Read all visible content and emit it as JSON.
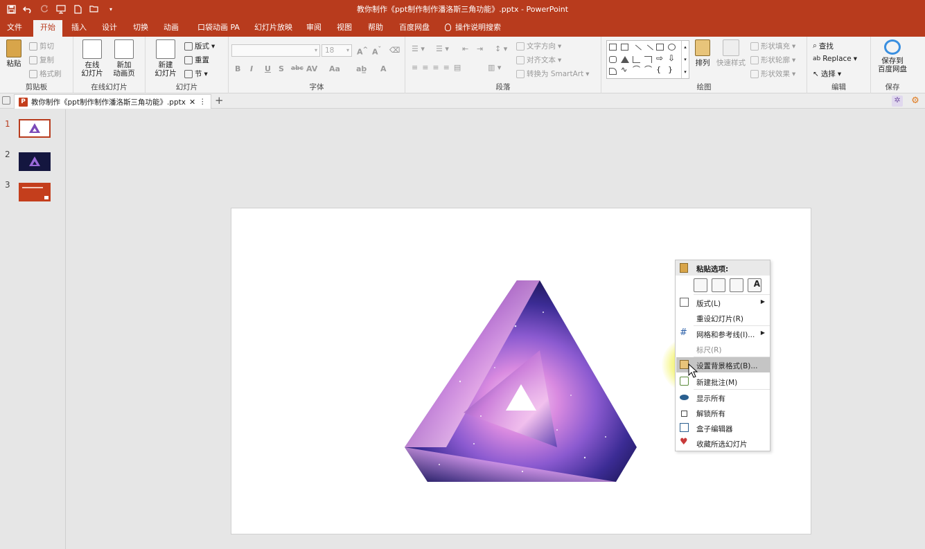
{
  "window": {
    "title": "教你制作《ppt制作制作潘洛斯三角功能》.pptx  -  PowerPoint"
  },
  "ribbon_tabs": [
    "文件",
    "开始",
    "插入",
    "设计",
    "切换",
    "动画",
    "口袋动画 PA",
    "幻灯片放映",
    "审阅",
    "视图",
    "帮助",
    "百度网盘",
    "操作说明搜索"
  ],
  "active_tab": "开始",
  "ribbon": {
    "clipboard": {
      "paste": "粘贴",
      "cut": "剪切",
      "copy": "复制",
      "format_painter": "格式刷",
      "label": "剪贴板"
    },
    "online": {
      "online_slide": "在线\n幻灯片",
      "new_anim": "新加\n动画页",
      "label": "在线幻灯片"
    },
    "slides": {
      "new_slide": "新建\n幻灯片",
      "layout": "版式",
      "reset": "重置",
      "section": "节",
      "label": "幻灯片"
    },
    "font": {
      "size": "18",
      "label": "字体",
      "buttons": [
        "B",
        "I",
        "U",
        "S",
        "abc",
        "AV",
        "Aa",
        "A"
      ]
    },
    "paragraph": {
      "text_dir": "文字方向",
      "align_text": "对齐文本",
      "smartart": "转换为 SmartArt",
      "label": "段落"
    },
    "drawing": {
      "arrange": "排列",
      "quick_styles": "快速样式",
      "fill": "形状填充",
      "outline": "形状轮廓",
      "effects": "形状效果",
      "label": "绘图"
    },
    "editing": {
      "find": "查找",
      "replace": "Replace",
      "select": "选择",
      "label": "编辑"
    },
    "save": {
      "save_to": "保存到\n百度网盘",
      "label": "保存"
    }
  },
  "doc_tab": {
    "name": "教你制作《ppt制作制作潘洛斯三角功能》.pptx"
  },
  "thumbnails": [
    {
      "num": "1",
      "selected": true,
      "bg": "#ffffff"
    },
    {
      "num": "2",
      "selected": false,
      "bg": "#14163f"
    },
    {
      "num": "3",
      "selected": false,
      "bg": "#c43e1c"
    }
  ],
  "context_menu": {
    "header": "粘贴选项:",
    "items": [
      {
        "label": "版式(L)",
        "submenu": true,
        "icon": "layout-icon"
      },
      {
        "label": "重设幻灯片(R)",
        "submenu": false,
        "icon": ""
      },
      {
        "label": "网格和参考线(I)...",
        "submenu": true,
        "icon": "grid-icon"
      },
      {
        "label": "标尺(R)",
        "submenu": false,
        "icon": ""
      },
      {
        "label": "设置背景格式(B)...",
        "submenu": false,
        "icon": "format-background-icon",
        "highlighted": true
      },
      {
        "label": "新建批注(M)",
        "submenu": false,
        "icon": "comment-icon"
      },
      {
        "label": "显示所有",
        "submenu": false,
        "icon": "eye-icon"
      },
      {
        "label": "解锁所有",
        "submenu": false,
        "icon": "unlock-icon"
      },
      {
        "label": "盒子编辑器",
        "submenu": false,
        "icon": "edit-icon"
      },
      {
        "label": "收藏所选幻灯片",
        "submenu": false,
        "icon": "favorite-icon"
      }
    ]
  },
  "colors": {
    "accent": "#b83b1d",
    "galaxy_dark": "#1b1650",
    "galaxy_light": "#f0b8ea"
  }
}
